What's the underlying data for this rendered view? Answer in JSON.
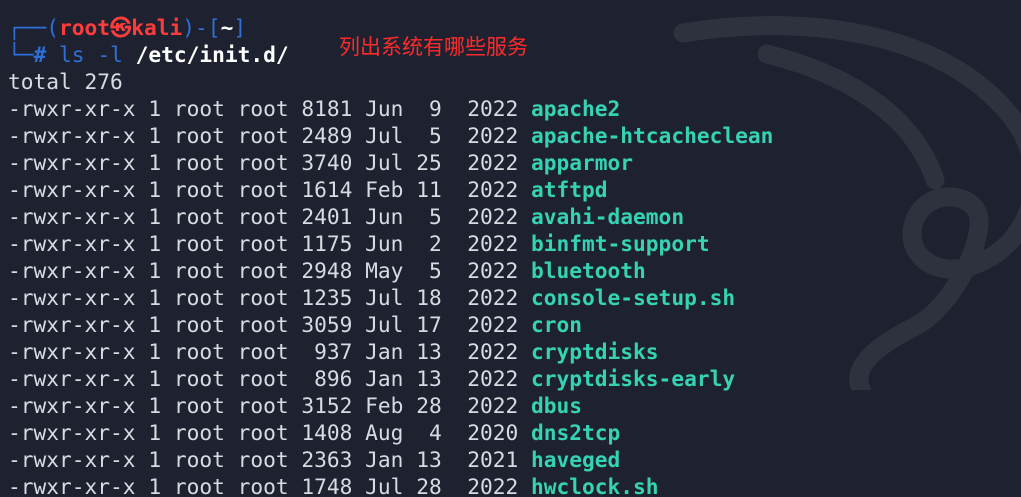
{
  "prompt": {
    "open_bracket": "┌──(",
    "user": "root",
    "separator_icon": "kali-skull-icon",
    "host": "kali",
    "mid": ")-[",
    "path": "~",
    "close": "]",
    "corner": "└─",
    "hash": "#"
  },
  "command": {
    "name": "ls -l",
    "arg": "/etc/init.d/"
  },
  "annotation": "列出系统有哪些服务",
  "output": {
    "total": "total 276",
    "entries": [
      {
        "perm": "-rwxr-xr-x 1 root root 8181 Jun  9  2022 ",
        "name": "apache2"
      },
      {
        "perm": "-rwxr-xr-x 1 root root 2489 Jul  5  2022 ",
        "name": "apache-htcacheclean"
      },
      {
        "perm": "-rwxr-xr-x 1 root root 3740 Jul 25  2022 ",
        "name": "apparmor"
      },
      {
        "perm": "-rwxr-xr-x 1 root root 1614 Feb 11  2022 ",
        "name": "atftpd"
      },
      {
        "perm": "-rwxr-xr-x 1 root root 2401 Jun  5  2022 ",
        "name": "avahi-daemon"
      },
      {
        "perm": "-rwxr-xr-x 1 root root 1175 Jun  2  2022 ",
        "name": "binfmt-support"
      },
      {
        "perm": "-rwxr-xr-x 1 root root 2948 May  5  2022 ",
        "name": "bluetooth"
      },
      {
        "perm": "-rwxr-xr-x 1 root root 1235 Jul 18  2022 ",
        "name": "console-setup.sh"
      },
      {
        "perm": "-rwxr-xr-x 1 root root 3059 Jul 17  2022 ",
        "name": "cron"
      },
      {
        "perm": "-rwxr-xr-x 1 root root  937 Jan 13  2022 ",
        "name": "cryptdisks"
      },
      {
        "perm": "-rwxr-xr-x 1 root root  896 Jan 13  2022 ",
        "name": "cryptdisks-early"
      },
      {
        "perm": "-rwxr-xr-x 1 root root 3152 Feb 28  2022 ",
        "name": "dbus"
      },
      {
        "perm": "-rwxr-xr-x 1 root root 1408 Aug  4  2020 ",
        "name": "dns2tcp"
      },
      {
        "perm": "-rwxr-xr-x 1 root root 2363 Jan 13  2021 ",
        "name": "haveged"
      },
      {
        "perm": "-rwxr-xr-x 1 root root 1748 Jul 28  2022 ",
        "name": "hwclock.sh"
      }
    ]
  },
  "colors": {
    "background": "#1e2230",
    "text": "#d8dbe2",
    "prompt_frame": "#2f6fd8",
    "prompt_user": "#ff3c3c",
    "filename": "#35d3b2",
    "annotation": "#ff2a2a"
  }
}
